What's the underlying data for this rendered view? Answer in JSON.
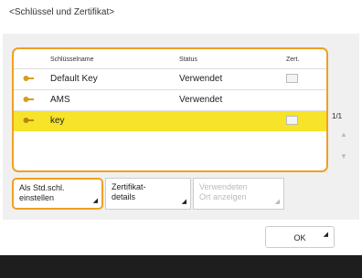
{
  "title": "<Schlüssel und Zertifikat>",
  "table": {
    "headers": [
      "Schlüsselname",
      "Status",
      "Zert."
    ],
    "rows": [
      {
        "name": "Default Key",
        "status": "Verwendet",
        "has_cert": true
      },
      {
        "name": "AMS",
        "status": "Verwendet",
        "has_cert": false
      },
      {
        "name": "key",
        "status": "",
        "has_cert": true,
        "selected": true
      }
    ]
  },
  "pager": "1/1",
  "buttons": {
    "set_default": [
      "Als Std.schl.",
      "einstellen"
    ],
    "cert_details": [
      "Zertifikat-",
      "details"
    ],
    "show_location": [
      "Verwendeten",
      "Ort anzeigen"
    ]
  },
  "ok_label": "OK",
  "colors": {
    "accent": "#f0a020",
    "selected_row": "#f6e32a",
    "footer": "#1e1e1e"
  }
}
